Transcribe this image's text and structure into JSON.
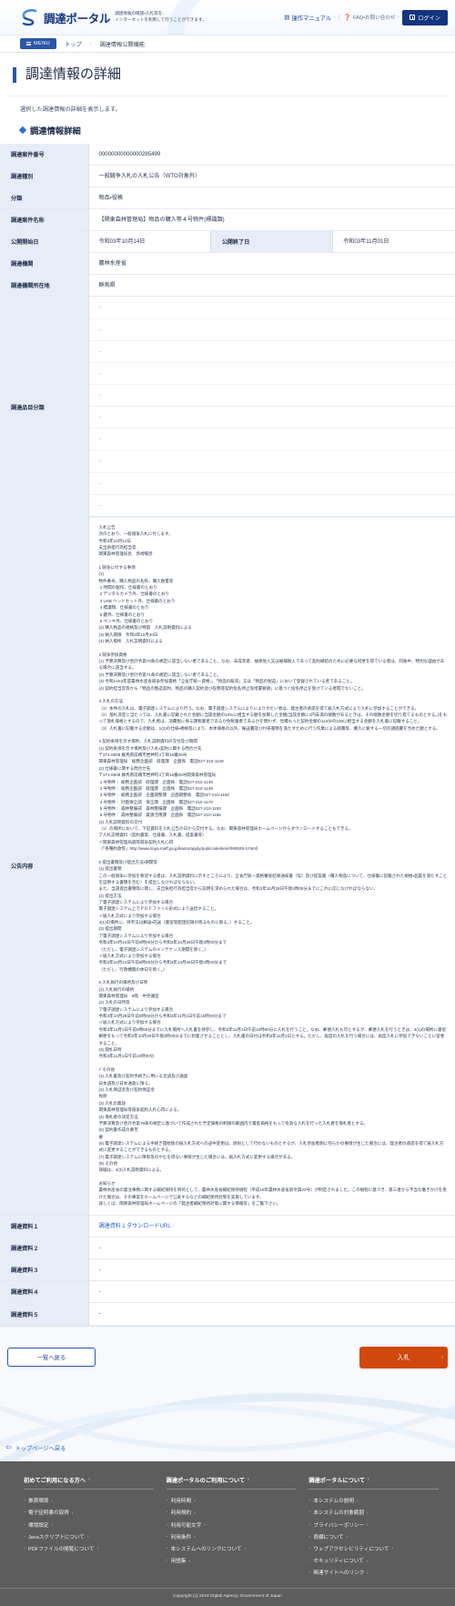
{
  "header": {
    "brand_name": "調達ポータル",
    "tagline_line1": "調達情報の確認・入札等を、",
    "tagline_line2": "インターネットを利用して行うことができます。",
    "manual_label": "操作マニュアル",
    "faq_label": "FAQ・お問い合わせ",
    "login_label": "ログイン",
    "separator": "|",
    "chevron": "›"
  },
  "breadcrumb": {
    "menu_label": "MENU",
    "items": [
      "トップ",
      "調達情報公開機能"
    ],
    "separator": "›"
  },
  "page": {
    "title": "調達情報の詳細",
    "lede": "選択した調達情報の詳細を表示します。",
    "section_title": "調達情報詳細"
  },
  "detail": {
    "rows": [
      {
        "label": "調達案件番号",
        "value": "00000000000000285499"
      },
      {
        "label": "調達種別",
        "value": "一般競争入札の入札公告（WTO対象外）"
      },
      {
        "label": "分類",
        "value": "物品・役務"
      },
      {
        "label": "調達案件名称",
        "value": "【関東森林管理局】物品の購入等４号物件(標識類)"
      }
    ],
    "split_row": {
      "label1": "公開開始日",
      "value1": "令和03年10月14日",
      "label2": "公開終了日",
      "value2": "令和03年11月01日"
    },
    "rows2": [
      {
        "label": "調達機関",
        "value": "農林水産省"
      },
      {
        "label": "調達機関所在地",
        "value": "群馬県"
      }
    ],
    "item_category": {
      "label": "調達品目分類",
      "values": [
        "-",
        "-",
        "-",
        "-",
        "-",
        "-",
        "-",
        "-",
        "-",
        "-"
      ]
    },
    "announcement": {
      "label": "公告内容",
      "text": "入札公告\n次のとおり、一般競争入札に付します。\n令和3年10月14日\n支出負担行為担当官\n関東森林管理局長　赤崎暢彦\n\n1 競争に付する事項\n(1)\n物件番号、購入物品の名称、購入数量等\n 1 時間の製作、仕様書のとおり\n 2 デジタルカメラ外、仕様書のとおり\n 3 USB ヘッドセット外、仕様書のとおり\n 4 標識類、仕様書のとおり\n 5 鍵外、仕様書のとおり\n 6 ペンキ外、仕様書のとおり\n(2) 購入物品の規格及び特質　入札説明資料による\n(3) 納入期限　令和3年12月20日\n(4) 納入場所　入札説明資料による\n\n2 競争参加資格\n(1) 予算決算及び会計令第70条の規定に該当しない者であること。なお、未成年者、被保佐人又は被補助人であって契約締結のために必要な同意を得ている者は、同条中、特別な理由がある場合に該当する。\n(2) 予算決算及び会計令第71条の規定に該当しない者であること。\n(3) 令和1・2・3年度農林水産省競争参加資格「全省庁統一資格」、「物品の販売」又は「物品の製造」において登録されている者であること。\n(4) 契約担当官等から「物品の製造契約、物品の購入契約及び役務等契約指名停止等措置要領」に基づく指名停止を受けている者間でないこと。\n\n3 入札の方法\n（1）本件の入札は、電子調達システムにより行う。なお、電子調達システムによりによりがたい者は、発注者の承諾を得て紙入札方式により入札に参加することができる。\n（2）落札決定に当たっては、入札書に記載された金額に当該金額の10%に相当する額を加算した金額(当該金額に1円未満の端数があるときは、その端数金額を切り捨てるものとする。)をもって落札価格とするので、入札者は、消費税に係る課税業者であるか免税業者であるかを問わず、見積もった契約金額の110分の100に相当する金額を入札書に記載すること。\n（3）入札書に記載する金額は、1(2)の仕様・規格等により、本体価格の以外、輸送費及び付帯書類を満たすために行う作業による経費等、購入に要する一切の諸経費を含めた額とする。\n\n4 契約条項を示す場所、入札説明資料の交付及び期間\n(1) 契約条項を示す場所及び入札・契約に関する問合せ先\n〒371-8508 群馬県前橋市岩神町4丁目16番25号\n関東森林管理局　総務企画部　経理課　企画係　電話027-210-1149\n(2) 仕様書に関する問合せ先\n〒371-8508 群馬県前橋市岩神町4丁目16番25号関東森林管理局\n 1 号物件： 総務企画部　経理課　企画係　電話027-210-1149\n 2 号物件： 総務企画部　経理課　企画係　電話027-210-1149\n 3 号物件： 総務企画部　企画調整課　企画調整係　電話027-210-1150\n 4 号物件： 計画保全部　保全課　企画係　電話027-210-1178\n 5 号物件： 森林整備部　森林整備課　企画係　電話027-210-1183\n 6 号物件： 森林整備部　資源活用課　企画係　電話027-210-1186\n(3) 入札説明資料の交付\n（1）の場所において、下記資料を入札公告の日から交付する。なお、関東森林管理局ホームページからダウンロードすることもできる。\nア入札説明資料（契約書案、仕様書、入札書、提案書等）\nイ関東森林管理局調等競争契約入札心得\n（「各種約款等」http://www.rinya.maff.go.jp/kanto/apply/publicsale/keiri/090929-3.html）\n\n5 提出書類及び提出方法・期間等\n(1) 提出書類\nこの一般競争に参加を希望する者は、入札説明資料に示すところにより、全省庁統一資格審査結果通知書（写）及び提案書（購入物品について、仕様書に記載された規格・品質を満たすことを証明する書類を含む）を提出しなければならない。\nまた、当該提出書類等に関し、支出負担行為担当官から説明を求められた場合は、令和3年10月28日午後3時00分までにこれに応じなければならない。\n(2) 提出方法\nア電子調達システムにより参加する場合\n電子調達システム上でＰＤＦファイル形式により送信すること。\nイ紙入札方式により参加する場合\n4(1)の場所に、持参又は郵送・託送（書留等配達記録の残るものに限る。）すること。\n(3) 提出期間\nア電子調達システムにより参加する場合\n令和3年10月14日午前9時00分から令和3年10月28日午後3時00分まで\n（ただし、電子調達システムのメンテナンス期間を除く。）\nイ紙入札方式により参加する場合\n令和3年10月14日午前9時00分から令和3年10月28日午後3時00分まで\n（ただし、行政機関の休日を除く。）\n\n6 入札執行の場所及び日時\n(1) 入札執行の場所\n関東森林管理局　5階　中会議室\n(2) 入札の日時等\nア電子調達システムにより参加する場合\n令和3年10月29日午前9時00分から令和3年11月1日午前10時00分まで\nイ紙入札方式により参加する場合\n令和3年11月1日午前9時55分までに入札場所へ入札書を持参し、令和3年11月1日午前10時00分に入札を行うこと。なお、郵便入札も可とするが、郵便入札を行うときは、4(1)の場所に書留郵便をもって令和3年10月29日午後3時00分までに到着させることとし、入札書の日付は令和3年11月1日とする。ただし、再度の入札を行う場合には、再度入札に参加できないことに留意すること。\n(3) 開札日時\n令和3年11月1日午前10時00分\n\n7 その他\n(1) 入札書及び契約手続きに用いる言語及び通貨\n日本語及び日本通貨に限る。\n(2) 入札保証金及び契約保証金\n免除\n(3) 入札の無効\n関東森林管理局等競争契約入札心得による。\n(4) 落札者の決定方法\n予算決算及び会計令第79条の規定に基づいて作成された予定価格の制限の範囲内で最低価格をもって有効な入札を行った入札者を落札者とする。\n(5) 契約書作成の要否\n要\n(6) 電子調達システムによる手続き開始後の紙入札方式への途中変更は、原則として行わないものとするが、入札参加者側に何らかの事情が生じた場合には、発注者の承諾を得て紙入札方式に変更することができるものとする。\n(7) 電子調達システムに障害等のやむを得ない事情が生じた場合には、紙入札方式に変更する場合がある。\n(8) その他\n詳細は、4(3)入札説明資料による。\n\nお知らせ\n農林水産省の発注事務に関する綱紀保持を目的として、農林水産省綱紀保持規程（平成19年農林水産省訓令第22号）が制定されました。この規程に基づき、第三者から不当な働きかけを受けた場合は、その事案をホームページで公表するなどの綱紀保持対策を実施しています。\n詳しくは、関東森林管理局ホームページの「発注者綱紀保持対策に関する情報等」をご覧下さい。"
    },
    "attachments": [
      {
        "label": "調達資料１",
        "value": "調達資料１ダウンロードURL",
        "is_link": true
      },
      {
        "label": "調達資料２",
        "value": "-",
        "is_link": false
      },
      {
        "label": "調達資料３",
        "value": "-",
        "is_link": false
      },
      {
        "label": "調達資料４",
        "value": "-",
        "is_link": false
      },
      {
        "label": "調達資料５",
        "value": "-",
        "is_link": false
      }
    ]
  },
  "actions": {
    "back_label": "一覧へ戻る",
    "bid_label": "入札",
    "chevron": "›",
    "top_link_label": "トップページへ戻る"
  },
  "footer": {
    "columns": [
      {
        "heading": "初めてご利用になる方へ",
        "links": [
          "推奨環境",
          "電子証明書の取得",
          "環境設定",
          "Javaスクリプトについて",
          "PDFファイルの閲覧について"
        ]
      },
      {
        "heading": "調達ポータルのご利用について",
        "links": [
          "利用時間",
          "利用規約",
          "利用可能文字",
          "利用条件",
          "本システムへのリンクについて",
          "用語集"
        ]
      },
      {
        "heading": "調達ポータルについて",
        "links": [
          "本システムの説明",
          "本システムの対象範囲",
          "プライバシーポリシー",
          "商標について",
          "ウェブアクセシビリティについて",
          "セキュリティについて",
          "関連サイトへのリンク"
        ]
      }
    ],
    "chevron": "›",
    "copyright": "Copyright (c) 2018 Digital Agency, Government of Japan"
  },
  "colors": {
    "brand_navy": "#13357f",
    "accent_blue": "#2b56a8",
    "bid_orange": "#d1480c",
    "table_header_bg": "#e6edf7",
    "footer_bg": "#5d5d5d"
  }
}
